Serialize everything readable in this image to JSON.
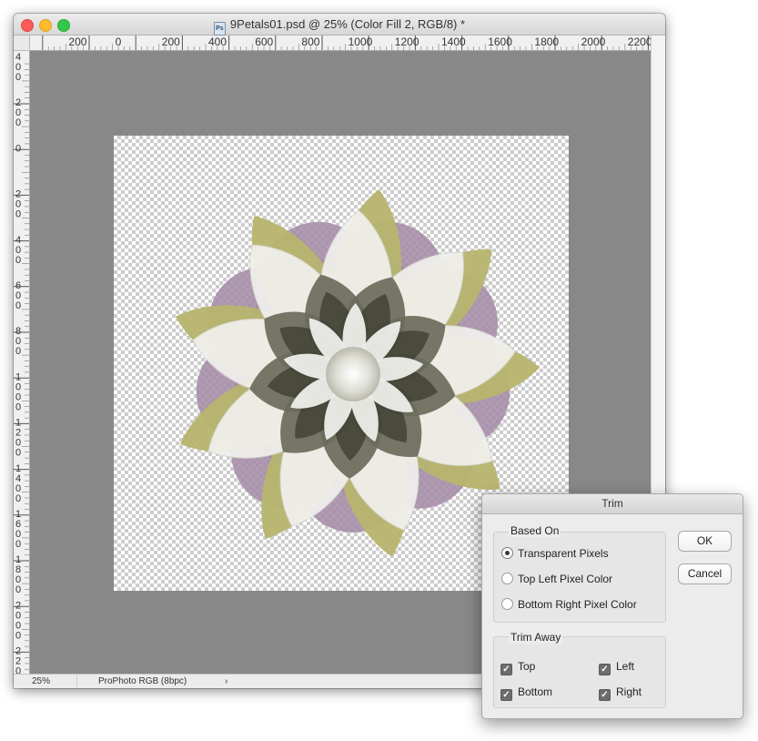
{
  "document": {
    "title": "9Petals01.psd @ 25% (Color Fill 2, RGB/8) *",
    "file_icon_label": "Ps",
    "ruler_h_labels": [
      "200",
      "0",
      "200",
      "400",
      "600",
      "800",
      "1000",
      "1200",
      "1400",
      "1600",
      "1800",
      "2000",
      "2200"
    ],
    "ruler_v_labels": [
      "400",
      "200",
      "0",
      "200",
      "400",
      "600",
      "800",
      "1000",
      "1200",
      "1400",
      "1600",
      "1800",
      "2000",
      "2200"
    ],
    "status": {
      "zoom": "25%",
      "profile": "ProPhoto RGB (8bpc)",
      "arrow": "›"
    },
    "colors": {
      "petal_outer": "#b7b46e",
      "petal_white": "#f1f1ee",
      "inner_dark": "#6b6b5c",
      "backdrop_purple": "#a38aa6",
      "canvas_gray": "#888888"
    }
  },
  "trim_dialog": {
    "title": "Trim",
    "based_on": {
      "label": "Based On",
      "options": [
        "Transparent Pixels",
        "Top Left Pixel Color",
        "Bottom Right Pixel Color"
      ],
      "selected": "Transparent Pixels"
    },
    "trim_away": {
      "label": "Trim Away",
      "top": "Top",
      "left": "Left",
      "bottom": "Bottom",
      "right": "Right",
      "checked": [
        "Top",
        "Left",
        "Bottom",
        "Right"
      ]
    },
    "ok_label": "OK",
    "cancel_label": "Cancel"
  }
}
